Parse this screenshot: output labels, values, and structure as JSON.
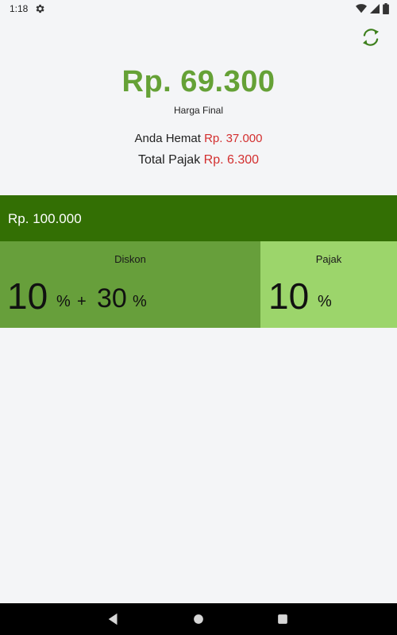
{
  "status_bar": {
    "time": "1:18",
    "icons": [
      "settings-icon",
      "wifi-icon",
      "signal-icon",
      "battery-icon"
    ]
  },
  "toolbar": {
    "refresh_icon": "refresh-icon"
  },
  "result": {
    "final_price": "Rp. 69.300",
    "final_label": "Harga Final",
    "saving_label": "Anda Hemat",
    "saving_value": "Rp. 37.000",
    "tax_label": "Total Pajak",
    "tax_value": "Rp. 6.300"
  },
  "price_input": {
    "currency": "Rp.",
    "value": "100.000"
  },
  "discount": {
    "title": "Diskon",
    "first_value": "10",
    "first_unit": "%",
    "plus": "+",
    "second_value": "30",
    "second_unit": "%"
  },
  "tax": {
    "title": "Pajak",
    "value": "10",
    "unit": "%"
  },
  "nav": {
    "icons": [
      "back-icon",
      "home-icon",
      "recents-icon"
    ]
  },
  "colors": {
    "accent_green": "#65a136",
    "dark_green": "#336f04",
    "discount_green": "#679f3b",
    "tax_green": "#9cd56b",
    "red": "#d32f2f"
  }
}
